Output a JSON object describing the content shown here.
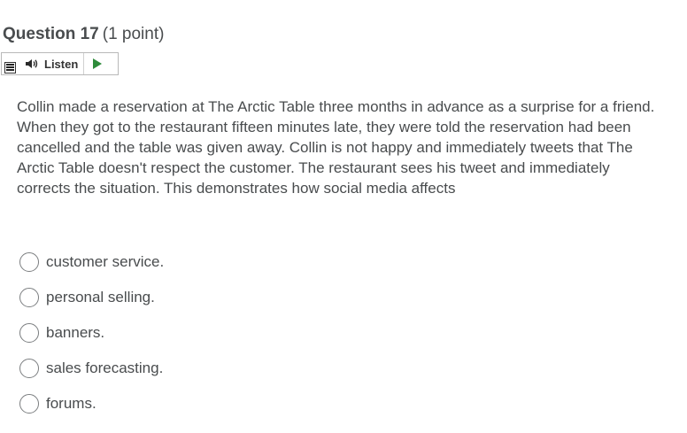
{
  "question": {
    "title": "Question 17",
    "points": "(1 point)",
    "body": "Collin made a reservation at The Arctic Table three months in advance as a surprise for a friend. When they got to the restaurant fifteen minutes late, they were told the reservation had been cancelled and the table was given away. Collin is not happy and immediately tweets that The Arctic Table doesn't respect the customer. The restaurant sees his tweet and immediately corrects the situation. This demonstrates how social media affects"
  },
  "listen": {
    "label": "Listen",
    "accent_color": "#2e8b3a"
  },
  "choices": [
    {
      "label": "customer service.",
      "selected": false
    },
    {
      "label": "personal selling.",
      "selected": false
    },
    {
      "label": "banners.",
      "selected": false
    },
    {
      "label": "sales forecasting.",
      "selected": false
    },
    {
      "label": "forums.",
      "selected": false
    }
  ]
}
